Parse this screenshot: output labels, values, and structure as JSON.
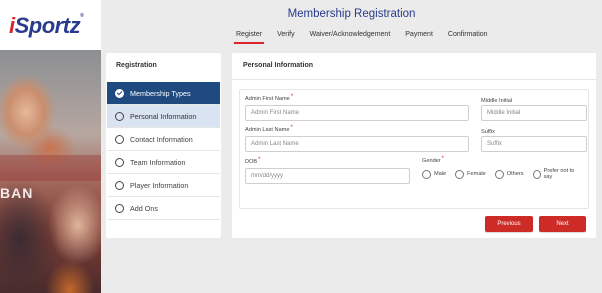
{
  "brand": {
    "logo_i": "i",
    "logo_rest": "Sportz",
    "logo_mark": "®",
    "jersey_text": "BAN"
  },
  "header": {
    "title": "Membership Registration"
  },
  "steps": [
    {
      "label": "Register",
      "active": true
    },
    {
      "label": "Verify",
      "active": false
    },
    {
      "label": "Waiver/Acknowledgement",
      "active": false
    },
    {
      "label": "Payment",
      "active": false
    },
    {
      "label": "Confirmation",
      "active": false
    }
  ],
  "sidebar": {
    "title": "Registration",
    "items": [
      {
        "label": "Membership Types",
        "state": "done",
        "icon": "check-circle-icon"
      },
      {
        "label": "Personal Information",
        "state": "current",
        "icon": "circle-icon"
      },
      {
        "label": "Contact Information",
        "state": "pending",
        "icon": "circle-icon"
      },
      {
        "label": "Team Information",
        "state": "pending",
        "icon": "circle-icon"
      },
      {
        "label": "Player Information",
        "state": "pending",
        "icon": "circle-icon"
      },
      {
        "label": "Add Ons",
        "state": "pending",
        "icon": "circle-icon"
      }
    ]
  },
  "form": {
    "section_title": "Personal Information",
    "first_name": {
      "label": "Admin First Name",
      "placeholder": "Admin First Name",
      "value": ""
    },
    "middle_initial": {
      "label": "Middle Initial",
      "placeholder": "Middle Initial",
      "value": ""
    },
    "last_name": {
      "label": "Admin Last Name",
      "placeholder": "Admin Last Name",
      "value": ""
    },
    "suffix": {
      "label": "Suffix",
      "placeholder": "Suffix",
      "value": ""
    },
    "dob": {
      "label": "DOB",
      "placeholder": "mm/dd/yyyy",
      "value": ""
    },
    "gender": {
      "label": "Gender",
      "options": [
        "Male",
        "Female",
        "Others",
        "Prefer not to say"
      ]
    },
    "required_mark": "*"
  },
  "buttons": {
    "previous": "Previous",
    "next": "Next"
  },
  "colors": {
    "accent": "#cc2b26",
    "brand_blue": "#2a3a8c",
    "nav_done": "#1e4a80",
    "nav_current": "#dae3f1"
  }
}
